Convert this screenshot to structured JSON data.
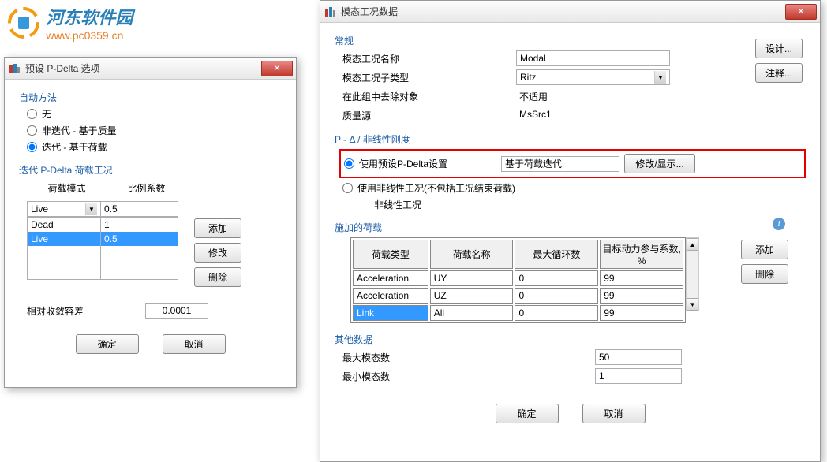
{
  "watermark": {
    "title": "河东软件园",
    "url": "www.pc0359.cn"
  },
  "leftWindow": {
    "title": "预设 P-Delta 选项",
    "autoMethod": {
      "legend": "自动方法",
      "options": [
        "无",
        "非迭代 - 基于质量",
        "迭代 - 基于荷载"
      ]
    },
    "loadCase": {
      "legend": "迭代 P-Delta 荷载工况",
      "col1Header": "荷载模式",
      "col2Header": "比例系数",
      "dropdownValue": "Live",
      "scaleInput": "0.5",
      "rows": [
        {
          "name": "Dead",
          "value": "1"
        },
        {
          "name": "Live",
          "value": "0.5"
        }
      ],
      "addBtn": "添加",
      "modifyBtn": "修改",
      "deleteBtn": "删除"
    },
    "tolerance": {
      "label": "相对收敛容差",
      "value": "0.0001"
    },
    "okBtn": "确定",
    "cancelBtn": "取消"
  },
  "rightWindow": {
    "title": "模态工况数据",
    "general": {
      "legend": "常规",
      "nameLabel": "模态工况名称",
      "nameValue": "Modal",
      "subtypeLabel": "模态工况子类型",
      "subtypeValue": "Ritz",
      "excludeLabel": "在此组中去除对象",
      "excludeValue": "不适用",
      "massLabel": "质量源",
      "massValue": "MsSrc1",
      "designBtn": "设计...",
      "notesBtn": "注释..."
    },
    "pdelta": {
      "legend": "P - Δ / 非线性刚度",
      "opt1": "使用预设P-Delta设置",
      "opt1Value": "基于荷载迭代",
      "opt1Btn": "修改/显示...",
      "opt2": "使用非线性工况(不包括工况结束荷载)",
      "nonlinearLabel": "非线性工况"
    },
    "loads": {
      "legend": "施加的荷载",
      "headers": [
        "荷载类型",
        "荷载名称",
        "最大循环数",
        "目标动力参与系数, %"
      ],
      "rows": [
        {
          "type": "Acceleration",
          "name": "UY",
          "cycles": "0",
          "ratio": "99"
        },
        {
          "type": "Acceleration",
          "name": "UZ",
          "cycles": "0",
          "ratio": "99"
        },
        {
          "type": "Link",
          "name": "All",
          "cycles": "0",
          "ratio": "99"
        }
      ],
      "addBtn": "添加",
      "deleteBtn": "删除"
    },
    "other": {
      "legend": "其他数据",
      "maxLabel": "最大模态数",
      "maxValue": "50",
      "minLabel": "最小模态数",
      "minValue": "1"
    },
    "okBtn": "确定",
    "cancelBtn": "取消"
  }
}
